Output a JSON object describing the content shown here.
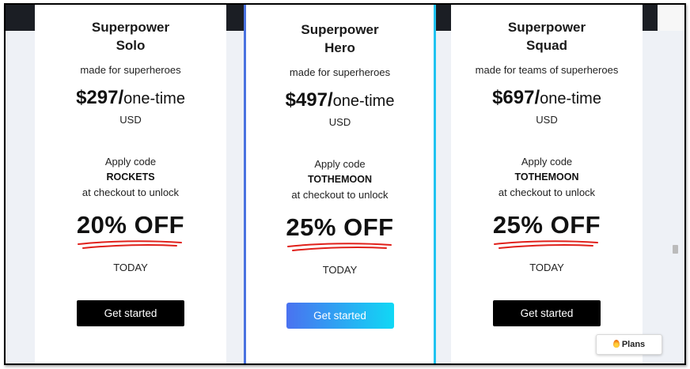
{
  "plans": [
    {
      "name_line1": "Superpower",
      "name_line2": "Solo",
      "tagline": "made for superheroes",
      "price": "$297/",
      "price_suffix": "one-time",
      "currency": "USD",
      "apply_label": "Apply code",
      "code": "ROCKETS",
      "unlock_label": "at checkout to unlock",
      "discount": "20% OFF",
      "today": "TODAY",
      "cta": "Get started"
    },
    {
      "name_line1": "Superpower",
      "name_line2": "Hero",
      "tagline": "made for superheroes",
      "price": "$497/",
      "price_suffix": "one-time",
      "currency": "USD",
      "apply_label": "Apply code",
      "code": "TOTHEMOON",
      "unlock_label": "at checkout to unlock",
      "discount": "25% OFF",
      "today": "TODAY",
      "cta": "Get started"
    },
    {
      "name_line1": "Superpower",
      "name_line2": "Squad",
      "tagline": "made for teams of superheroes",
      "price": "$697/",
      "price_suffix": "one-time",
      "currency": "USD",
      "apply_label": "Apply code",
      "code": "TOTHEMOON",
      "unlock_label": "at checkout to unlock",
      "discount": "25% OFF",
      "today": "TODAY",
      "cta": "Get started"
    }
  ],
  "plans_button": {
    "label": "Plans",
    "icon": "flame-icon"
  },
  "colors": {
    "top_bar": "#1b1e24",
    "hero_border_left": "#4a72e0",
    "hero_border_right": "#1fc3f0",
    "hero_cta_gradient_start": "#4a72f0",
    "hero_cta_gradient_end": "#10d8f5",
    "underline_red": "#e0201a"
  }
}
